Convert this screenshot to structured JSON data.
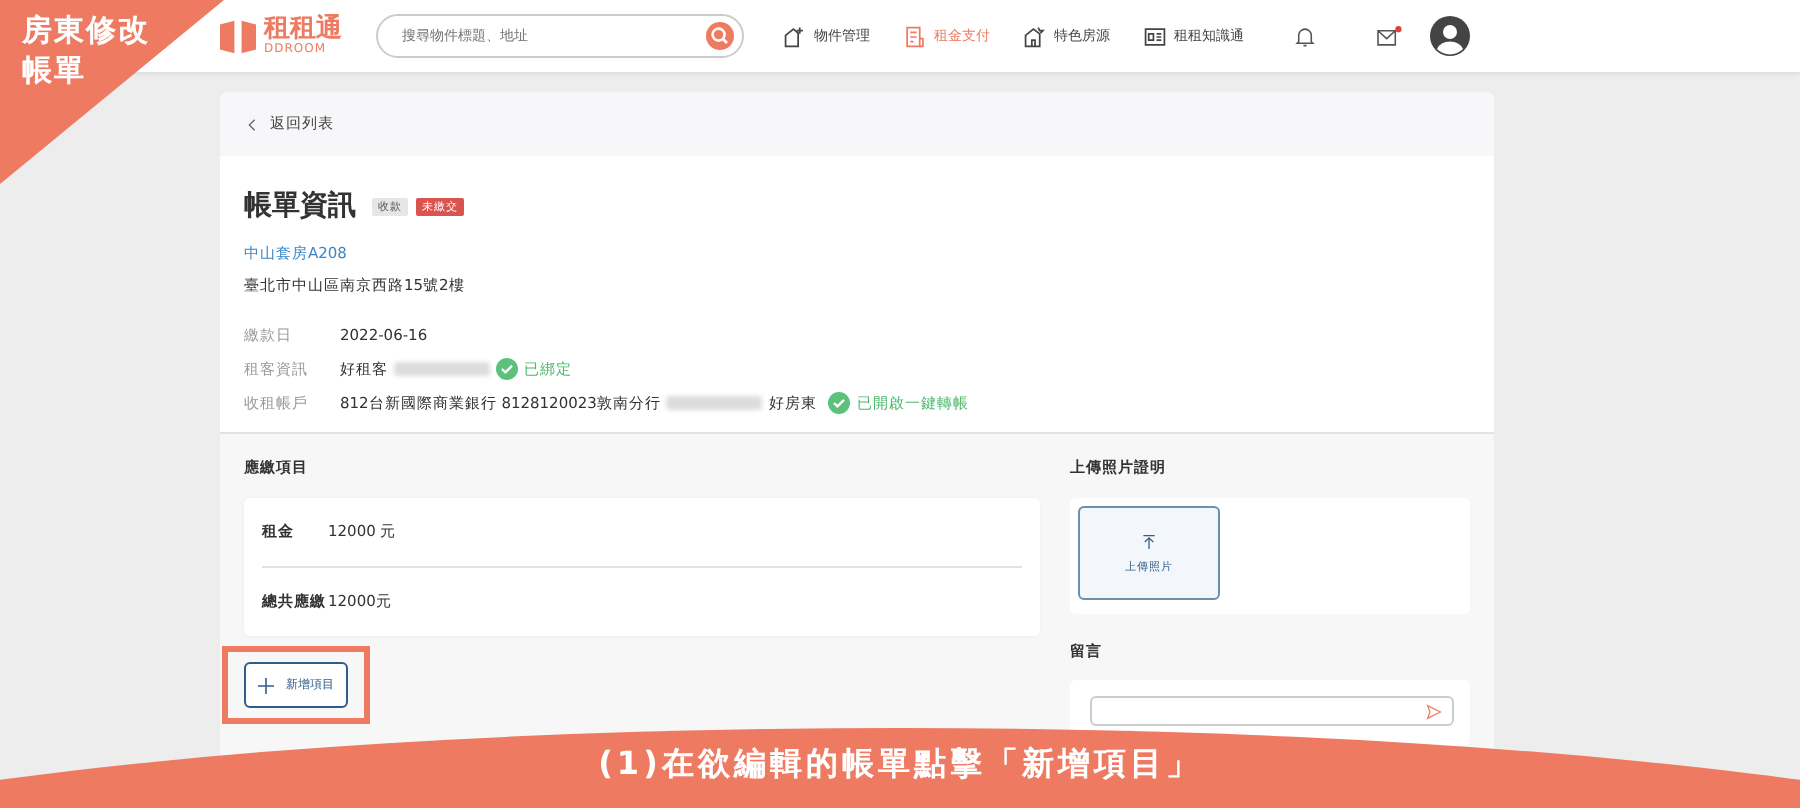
{
  "tutorial": {
    "corner_label": "房東修改帳單",
    "caption": "(1)在欲編輯的帳單點擊「新增項目」"
  },
  "header": {
    "logo": {
      "name": "租租通",
      "sub": "DDROOM"
    },
    "search": {
      "placeholder": "搜尋物件標題、地址"
    },
    "nav": [
      {
        "kind": "house",
        "label": "物件管理",
        "selected": false
      },
      {
        "kind": "receipt",
        "label": "租金支付",
        "selected": true
      },
      {
        "kind": "star-house",
        "label": "特色房源",
        "selected": false
      },
      {
        "kind": "news",
        "label": "租租知識通",
        "selected": false
      }
    ],
    "mail_unread": true
  },
  "back": "返回列表",
  "bill": {
    "title": "帳單資訊",
    "tags": [
      {
        "label": "收款",
        "color": "#e6e6e6"
      },
      {
        "label": "未繳交",
        "color": "#d9534f"
      }
    ],
    "property": "中山套房A208",
    "address": "臺北市中山區南京西路15號2樓",
    "details": [
      {
        "label": "繳款日",
        "value": "2022-06-16",
        "redacted": false
      },
      {
        "label": "租客資訊",
        "value": "好租客",
        "redacted": true,
        "status": "已綁定"
      },
      {
        "label": "收租帳戶",
        "value": "812台新國際商業銀行 8128120023敦南分行",
        "redacted": true,
        "suffix": "好房東",
        "status": "已開啟一鍵轉帳"
      }
    ]
  },
  "items": {
    "title": "應繳項目",
    "rows": [
      {
        "label": "租金",
        "value": "12000 元"
      }
    ],
    "total": {
      "label": "總共應繳",
      "value": "12000元"
    },
    "add_button": "新增項目",
    "highlighted": true
  },
  "upload": {
    "title": "上傳照片證明",
    "button": "上傳照片"
  },
  "message": {
    "title": "留言"
  }
}
